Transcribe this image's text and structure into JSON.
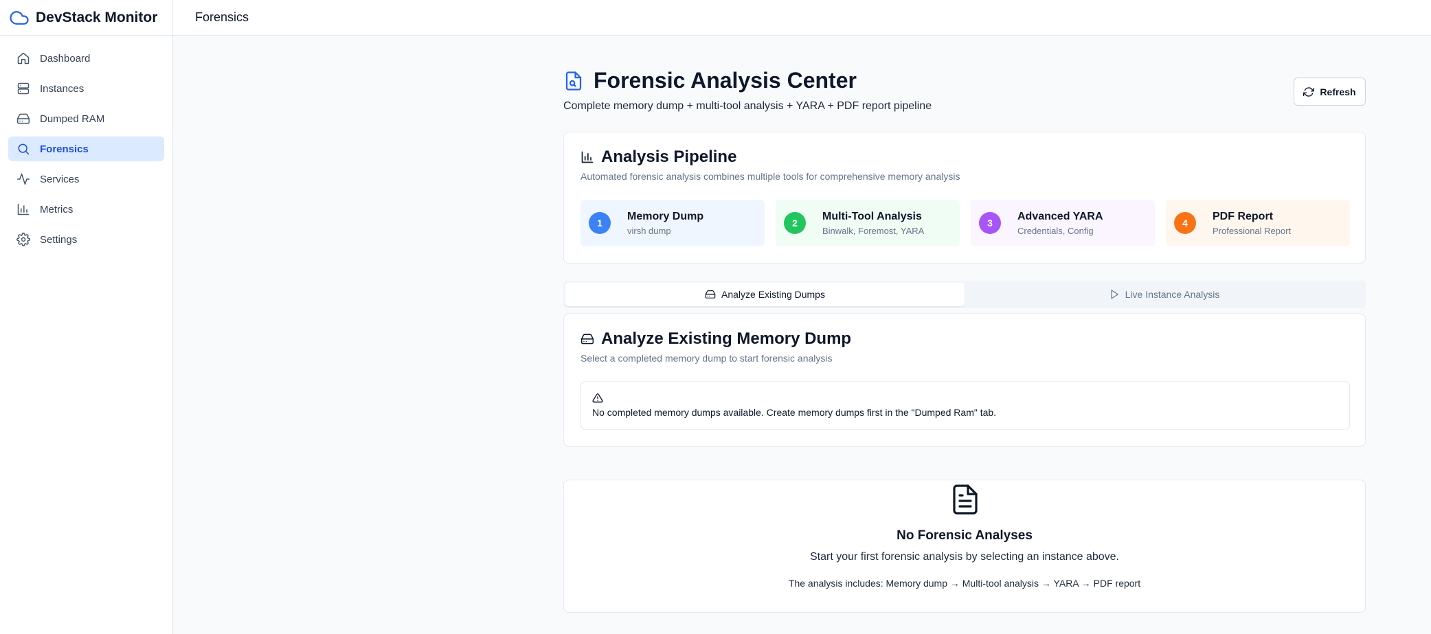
{
  "app": {
    "title": "DevStack Monitor"
  },
  "sidebar": {
    "items": [
      {
        "label": "Dashboard",
        "icon": "home-icon"
      },
      {
        "label": "Instances",
        "icon": "server-icon"
      },
      {
        "label": "Dumped RAM",
        "icon": "hard-drive-icon"
      },
      {
        "label": "Forensics",
        "icon": "search-icon",
        "active": true
      },
      {
        "label": "Services",
        "icon": "activity-icon"
      },
      {
        "label": "Metrics",
        "icon": "bar-chart-icon"
      },
      {
        "label": "Settings",
        "icon": "gear-icon"
      }
    ]
  },
  "topbar": {
    "title": "Forensics"
  },
  "header": {
    "title": "Forensic Analysis Center",
    "subtitle": "Complete memory dump + multi-tool analysis + YARA + PDF report pipeline",
    "refresh_label": "Refresh"
  },
  "pipeline": {
    "title": "Analysis Pipeline",
    "description": "Automated forensic analysis combines multiple tools for comprehensive memory analysis",
    "steps": [
      {
        "num": "1",
        "name": "Memory Dump",
        "sub": "virsh dump",
        "color": "#3b82f6",
        "bg": "#eff6ff"
      },
      {
        "num": "2",
        "name": "Multi-Tool Analysis",
        "sub": "Binwalk, Foremost, YARA",
        "color": "#22c55e",
        "bg": "#f0fdf4"
      },
      {
        "num": "3",
        "name": "Advanced YARA",
        "sub": "Credentials, Config",
        "color": "#a855f7",
        "bg": "#faf5ff"
      },
      {
        "num": "4",
        "name": "PDF Report",
        "sub": "Professional Report",
        "color": "#f97316",
        "bg": "#fff7ed"
      }
    ]
  },
  "tabs": {
    "existing": "Analyze Existing Dumps",
    "live": "Live Instance Analysis"
  },
  "analyze": {
    "title": "Analyze Existing Memory Dump",
    "description": "Select a completed memory dump to start forensic analysis",
    "alert": "No completed memory dumps available. Create memory dumps first in the \"Dumped Ram\" tab."
  },
  "empty": {
    "title": "No Forensic Analyses",
    "subtitle": "Start your first forensic analysis by selecting an instance above.",
    "note": "The analysis includes: Memory dump → Multi-tool analysis → YARA → PDF report"
  }
}
